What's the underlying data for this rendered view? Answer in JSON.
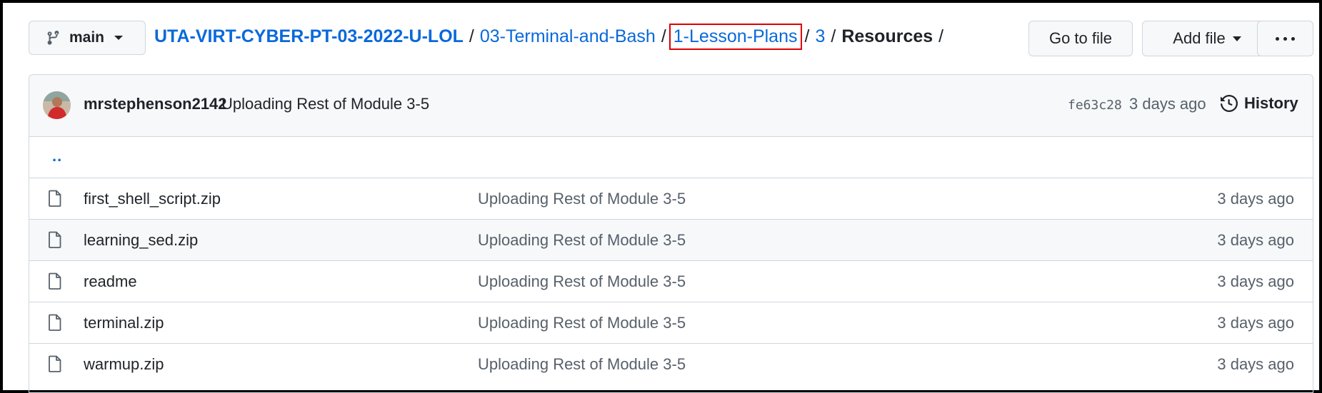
{
  "branch": {
    "name": "main"
  },
  "breadcrumb": {
    "repo": "UTA-VIRT-CYBER-PT-03-2022-U-LOL",
    "items": [
      "03-Terminal-and-Bash",
      "1-Lesson-Plans",
      "3"
    ],
    "current": "Resources",
    "separator": "/"
  },
  "toolbar": {
    "go_to_file": "Go to file",
    "add_file": "Add file"
  },
  "commit": {
    "author": "mrstephenson2142",
    "message": "Uploading Rest of Module 3-5",
    "sha": "fe63c28",
    "time": "3 days ago",
    "history_label": "History"
  },
  "parent_dir": "..",
  "files": [
    {
      "name": "first_shell_script.zip",
      "message": "Uploading Rest of Module 3-5",
      "age": "3 days ago"
    },
    {
      "name": "learning_sed.zip",
      "message": "Uploading Rest of Module 3-5",
      "age": "3 days ago"
    },
    {
      "name": "readme",
      "message": "Uploading Rest of Module 3-5",
      "age": "3 days ago"
    },
    {
      "name": "terminal.zip",
      "message": "Uploading Rest of Module 3-5",
      "age": "3 days ago"
    },
    {
      "name": "warmup.zip",
      "message": "Uploading Rest of Module 3-5",
      "age": "3 days ago"
    }
  ],
  "colors": {
    "link": "#0969da",
    "highlight": "#e00000",
    "border": "#d0d7de",
    "muted": "#57606a"
  },
  "icons": {
    "branch": "git-branch-icon",
    "file": "file-icon",
    "history": "history-clock-icon",
    "more": "kebab-horizontal-icon"
  }
}
